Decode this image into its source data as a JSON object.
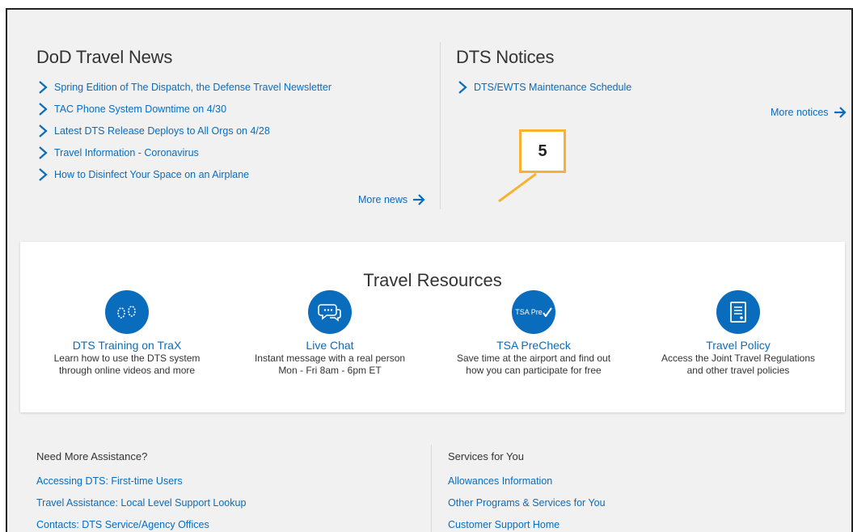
{
  "news": {
    "title": "DoD Travel News",
    "items": [
      "Spring Edition of The Dispatch, the Defense Travel Newsletter",
      "TAC Phone System Downtime on 4/30",
      "Latest DTS Release Deploys to All Orgs on 4/28",
      "Travel Information - Coronavirus",
      "How to Disinfect Your Space on an Airplane"
    ],
    "more_label": "More news"
  },
  "notices": {
    "title": "DTS Notices",
    "items": [
      "DTS/EWTS Maintenance Schedule"
    ],
    "more_label": "More notices"
  },
  "callout": {
    "label": "5",
    "color": "#f6b331"
  },
  "resources": {
    "title": "Travel Resources",
    "items": [
      {
        "icon": "footprints-icon",
        "title": "DTS Training on TraX",
        "desc1": "Learn how to use the DTS system",
        "desc2": "through online videos and more"
      },
      {
        "icon": "chat-bubbles-icon",
        "title": "Live Chat",
        "desc1": "Instant message with a real person",
        "desc2": "Mon - Fri 8am - 6pm ET"
      },
      {
        "icon": "tsa-precheck-icon",
        "icon_text": "TSA Pre",
        "title": "TSA PreCheck",
        "desc1": "Save time at the airport and find out",
        "desc2": "how you can participate for free"
      },
      {
        "icon": "policy-document-icon",
        "title": "Travel Policy",
        "desc1": "Access the Joint Travel Regulations",
        "desc2": "and other travel policies"
      }
    ]
  },
  "assistance": {
    "title": "Need More Assistance?",
    "links": [
      "Accessing DTS: First-time Users",
      "Travel Assistance: Local Level Support Lookup",
      "Contacts: DTS Service/Agency Offices"
    ]
  },
  "services": {
    "title": "Services for You",
    "links": [
      "Allowances Information",
      "Other Programs & Services for You",
      "Customer Support Home"
    ]
  },
  "colors": {
    "link": "#0a6cbd",
    "icon_bg": "#0a6cbd",
    "panel_bg": "#f1f1f1"
  }
}
